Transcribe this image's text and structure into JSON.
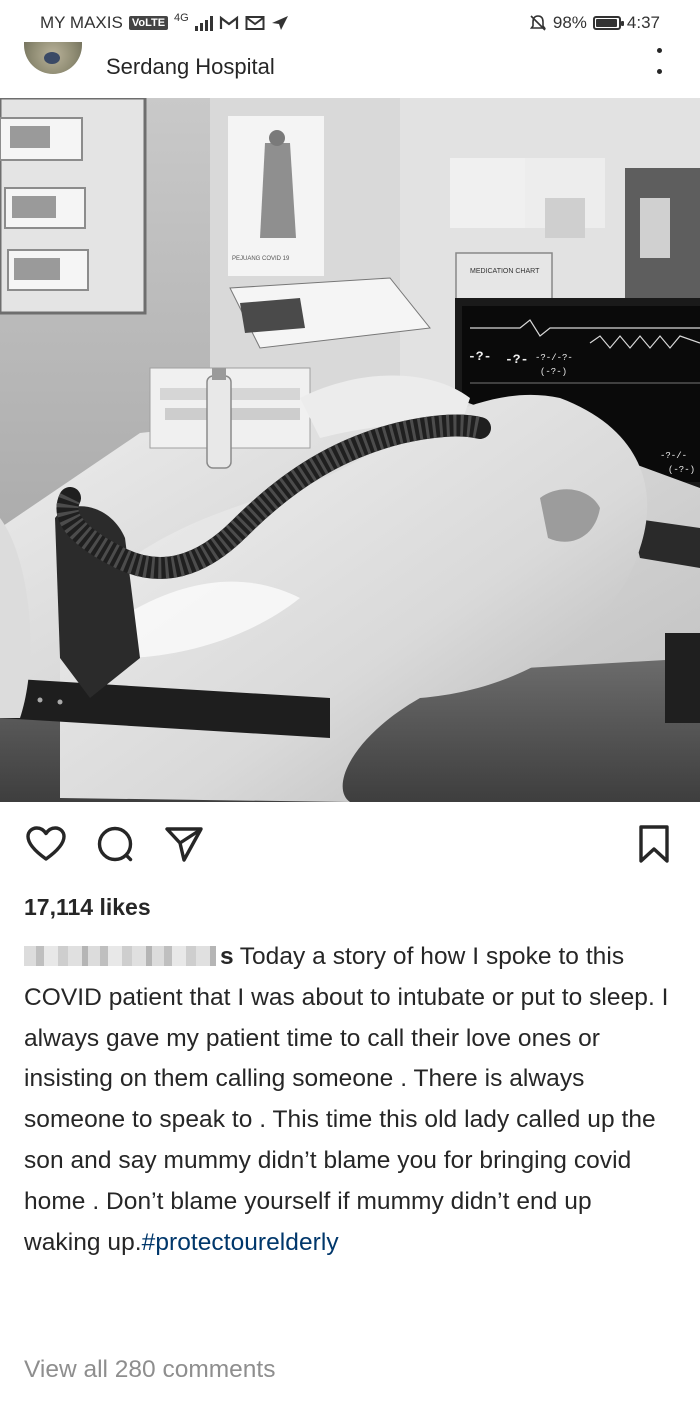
{
  "status_bar": {
    "carrier": "MY MAXIS",
    "volte": "VoLTE",
    "network": "4G",
    "battery_percent_text": "98%",
    "battery_level": 0.98,
    "time": "4:37"
  },
  "post": {
    "location": "Serdang Hospital",
    "likes": "17,114 likes",
    "caption": {
      "username_tail": "s",
      "text": "Today a story of how I spoke to this COVID patient that I was about to intubate or put to sleep. I always gave my patient time to call their love ones or insisting on them calling someone . There is always someone to speak to . This time this old lady called up the son and say mummy didn’t blame you for bringing covid home . Don’t blame yourself if mummy didn’t end up waking up.",
      "hashtag": "#protectourelderly"
    },
    "view_comments": "View all 280 comments"
  },
  "photo": {
    "poster_text": "PEJUANG COVID 19",
    "medication_chart_text": "MEDICATION CHART",
    "monitor_readouts": [
      "-?-",
      "-?-",
      "-?-/-?-",
      "(-?-)",
      "?-",
      "-?-/-",
      "(-?-)"
    ]
  },
  "icons": {
    "like": "heart-icon",
    "comment": "comment-icon",
    "share": "paper-plane-icon",
    "save": "bookmark-icon",
    "more": "more-options-icon"
  }
}
